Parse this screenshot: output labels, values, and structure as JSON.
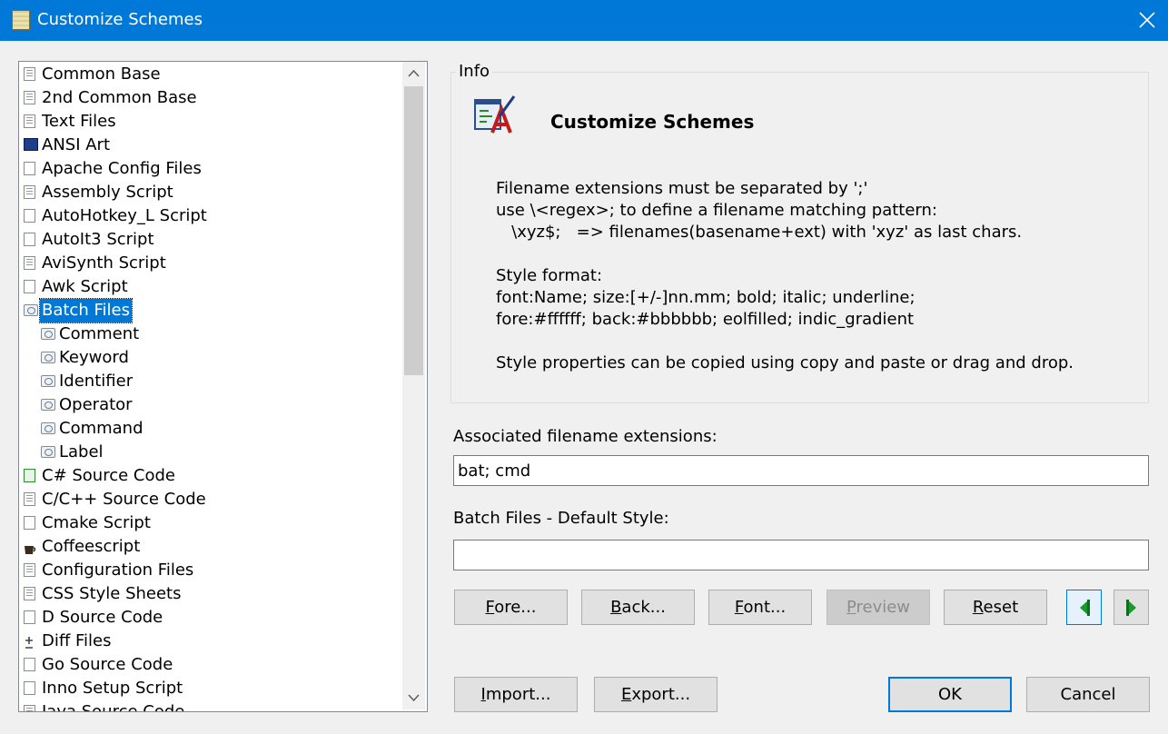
{
  "window": {
    "title": "Customize Schemes",
    "close_icon": "close-icon",
    "app_icon": "notepad-icon"
  },
  "tree": {
    "items": [
      {
        "label": "Common Base",
        "icon": "document-lines",
        "level": 0
      },
      {
        "label": "2nd Common Base",
        "icon": "document-lines",
        "level": 0
      },
      {
        "label": "Text Files",
        "icon": "document-lines",
        "level": 0
      },
      {
        "label": "ANSI Art",
        "icon": "monitor",
        "level": 0
      },
      {
        "label": "Apache Config Files",
        "icon": "document",
        "level": 0
      },
      {
        "label": "Assembly Script",
        "icon": "document-asm",
        "level": 0
      },
      {
        "label": "AutoHotkey_L Script",
        "icon": "document",
        "level": 0
      },
      {
        "label": "AutoIt3 Script",
        "icon": "document",
        "level": 0
      },
      {
        "label": "AviSynth Script",
        "icon": "document-lines",
        "level": 0
      },
      {
        "label": "Awk Script",
        "icon": "document",
        "level": 0
      },
      {
        "label": "Batch Files",
        "icon": "style",
        "level": 0,
        "selected": true
      },
      {
        "label": "Comment",
        "icon": "style",
        "level": 1
      },
      {
        "label": "Keyword",
        "icon": "style",
        "level": 1
      },
      {
        "label": "Identifier",
        "icon": "style",
        "level": 1
      },
      {
        "label": "Operator",
        "icon": "style",
        "level": 1
      },
      {
        "label": "Command",
        "icon": "style",
        "level": 1
      },
      {
        "label": "Label",
        "icon": "style",
        "level": 1
      },
      {
        "label": "C# Source Code",
        "icon": "document-green",
        "level": 0
      },
      {
        "label": "C/C++ Source Code",
        "icon": "document-lines",
        "level": 0
      },
      {
        "label": "Cmake Script",
        "icon": "document",
        "level": 0
      },
      {
        "label": "Coffeescript",
        "icon": "cup",
        "level": 0
      },
      {
        "label": "Configuration Files",
        "icon": "document-lines",
        "level": 0
      },
      {
        "label": "CSS Style Sheets",
        "icon": "document-lines",
        "level": 0
      },
      {
        "label": "D Source Code",
        "icon": "document",
        "level": 0
      },
      {
        "label": "Diff Files",
        "icon": "diff",
        "level": 0
      },
      {
        "label": "Go Source Code",
        "icon": "document",
        "level": 0
      },
      {
        "label": "Inno Setup Script",
        "icon": "document",
        "level": 0
      },
      {
        "label": "Java Source Code",
        "icon": "document-java",
        "level": 0
      }
    ]
  },
  "scrollbar": {
    "up_icon": "chevron-up-icon",
    "down_icon": "chevron-down-icon"
  },
  "info": {
    "group_label": "Info",
    "icon": "customize-schemes-icon",
    "title": "Customize Schemes",
    "lines": [
      "Filename extensions must be separated by ';'",
      "use \\<regex>; to define a filename matching pattern:",
      "   \\xyz$;   => filenames(basename+ext) with 'xyz' as last chars.",
      "Style format:",
      "font:Name; size:[+/-]nn.mm; bold; italic; underline;",
      "fore:#ffffff; back:#bbbbbb; eolfilled; indic_gradient",
      "Style properties can be copied using copy and paste or drag and drop."
    ]
  },
  "extensions": {
    "label": "Associated filename extensions:",
    "value": "bat; cmd"
  },
  "style": {
    "label": "Batch Files - Default Style:",
    "value": ""
  },
  "buttons": {
    "fore": {
      "pre": "",
      "u": "F",
      "post": "ore..."
    },
    "back": {
      "pre": "",
      "u": "B",
      "post": "ack..."
    },
    "font": {
      "pre": "",
      "u": "F",
      "post": "ont..."
    },
    "preview": {
      "pre": "",
      "u": "P",
      "post": "review"
    },
    "reset": {
      "pre": "",
      "u": "R",
      "post": "eset"
    },
    "prev_icon": "green-arrow-left-icon",
    "next_icon": "green-arrow-right-icon",
    "import": {
      "pre": "",
      "u": "I",
      "post": "mport..."
    },
    "export": {
      "pre": "",
      "u": "E",
      "post": "xport..."
    },
    "ok": "OK",
    "cancel": "Cancel"
  },
  "colors": {
    "accent": "#0078d7",
    "arrow_green": "#1a9a2a"
  }
}
